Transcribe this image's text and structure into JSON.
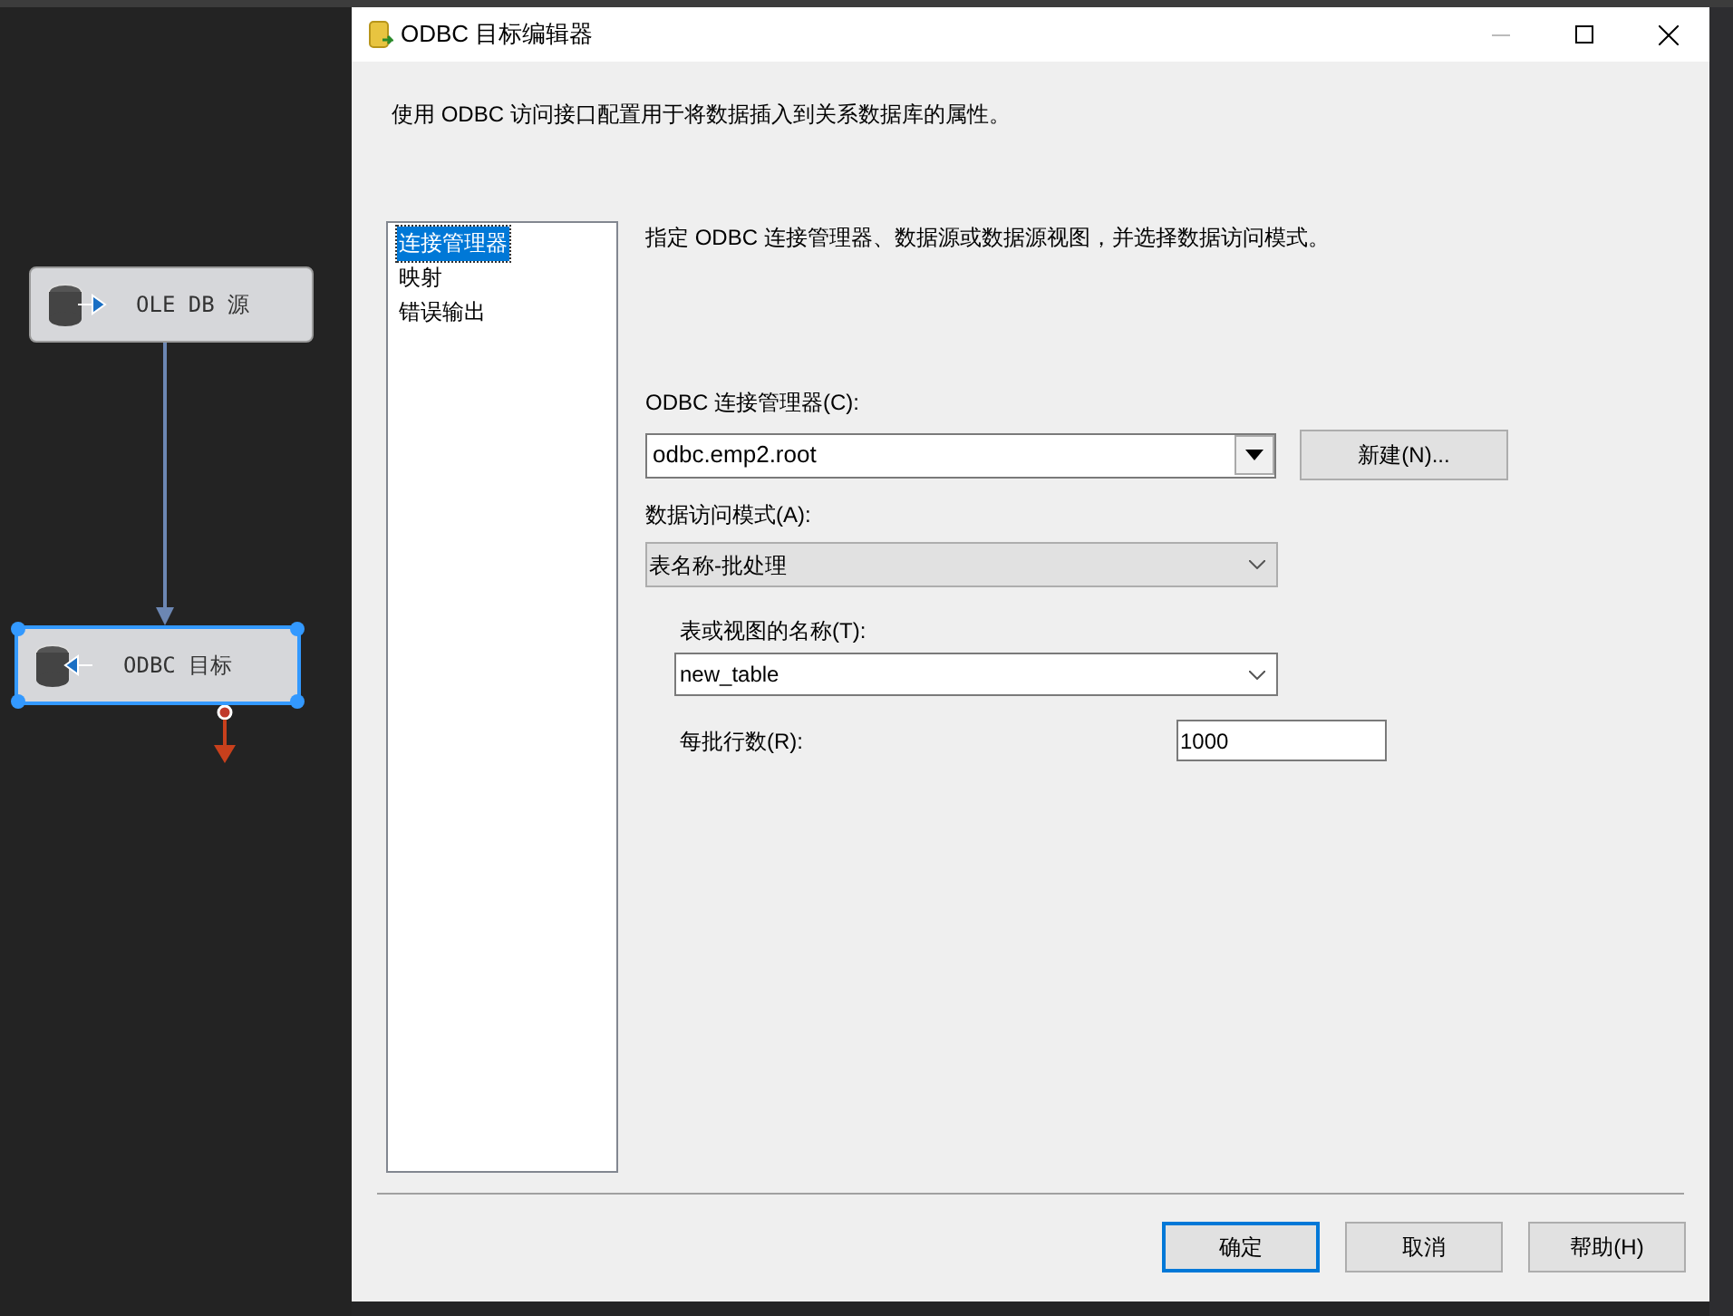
{
  "canvas": {
    "nodes": [
      {
        "kind": "source",
        "label": "OLE DB 源",
        "selected": false
      },
      {
        "kind": "destination",
        "label": "ODBC 目标",
        "selected": true
      }
    ]
  },
  "window": {
    "title": "ODBC 目标编辑器"
  },
  "description": "使用 ODBC 访问接口配置用于将数据插入到关系数据库的属性。",
  "sidebar": {
    "items": [
      {
        "label": "连接管理器",
        "selected": true
      },
      {
        "label": "映射",
        "selected": false
      },
      {
        "label": "错误输出",
        "selected": false
      }
    ]
  },
  "panel": {
    "heading": "指定 ODBC 连接管理器、数据源或数据源视图，并选择数据访问模式。",
    "connection_manager": {
      "label": "ODBC 连接管理器(C):",
      "value": "odbc.emp2.root"
    },
    "new_button": "新建(N)...",
    "access_mode": {
      "label": "数据访问模式(A):",
      "value": "表名称-批处理"
    },
    "table_name": {
      "label": "表或视图的名称(T):",
      "value": "new_table"
    },
    "rows_per_batch": {
      "label": "每批行数(R):",
      "value": "1000"
    }
  },
  "buttons": [
    {
      "label": "确定",
      "default": true
    },
    {
      "label": "取消",
      "default": false
    },
    {
      "label": "帮助(H)",
      "default": false
    }
  ]
}
